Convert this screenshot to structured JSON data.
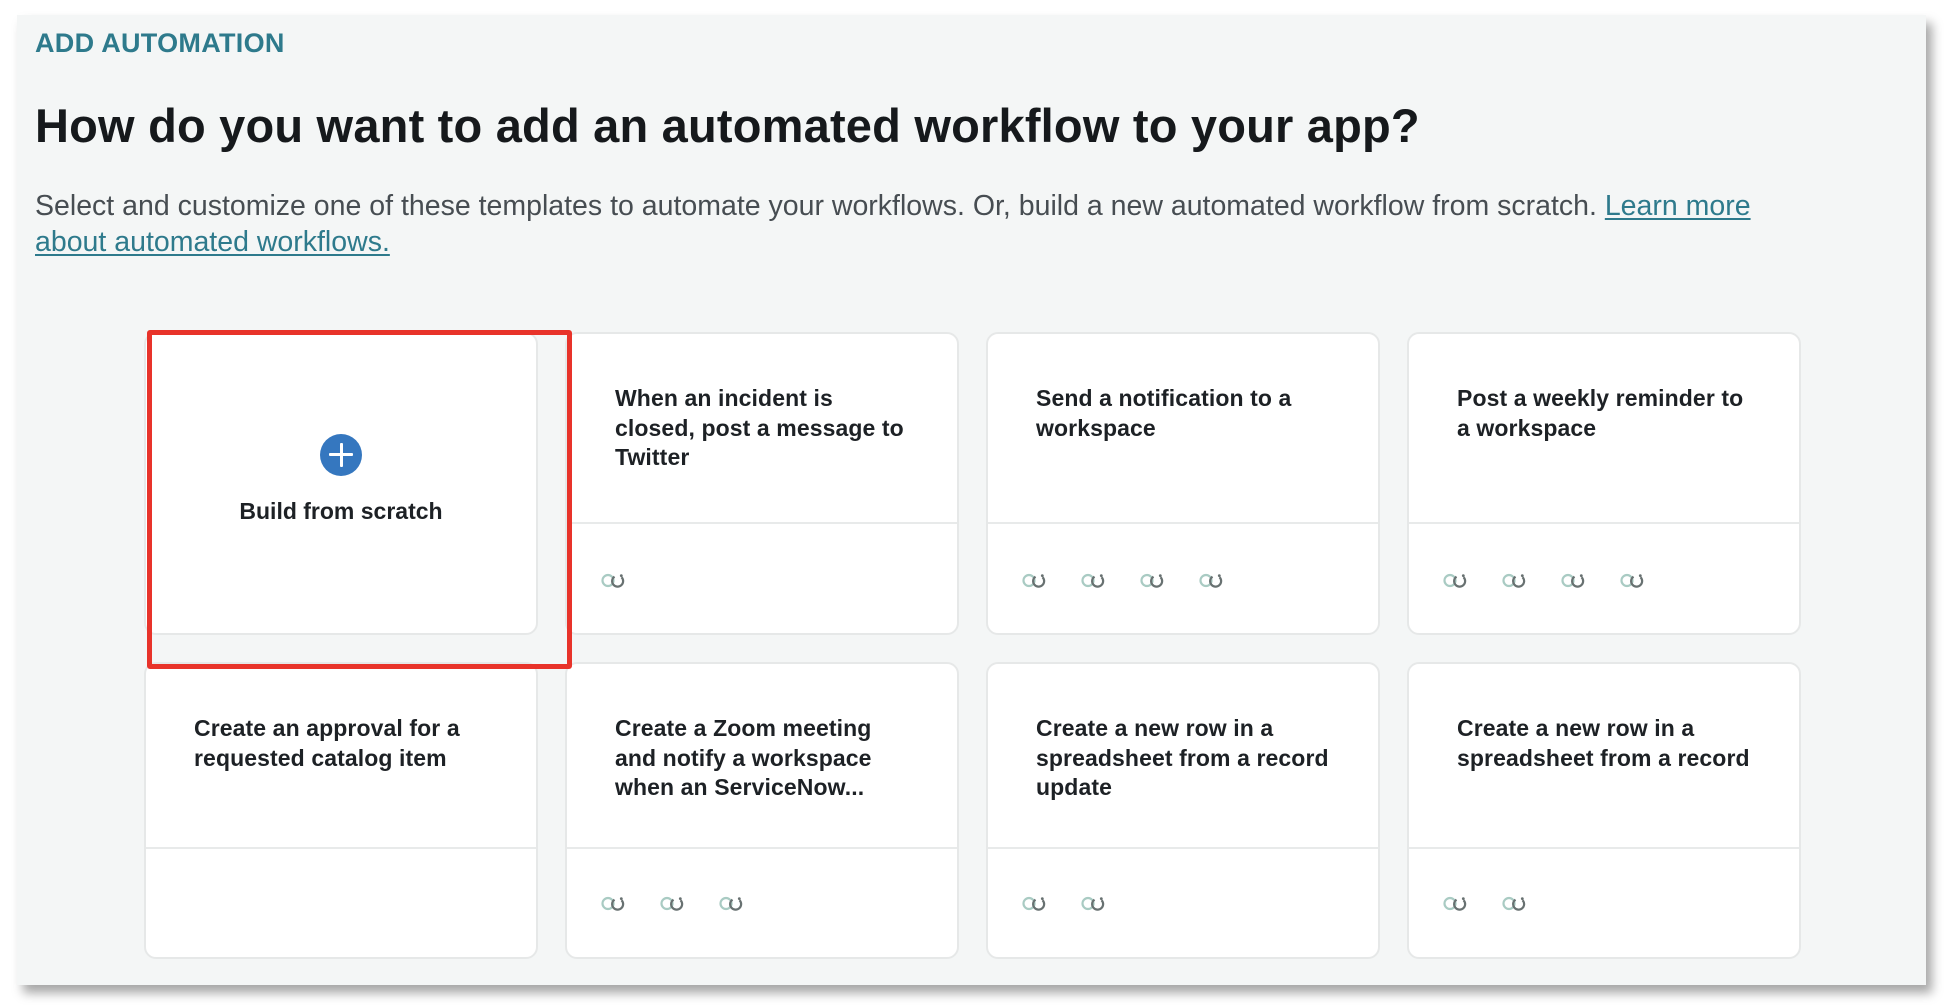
{
  "header": {
    "eyebrow": "ADD AUTOMATION",
    "title": "How do you want to add an automated workflow to your app?",
    "subtitle": "Select and customize one of these templates to automate your workflows. Or, build a new automated workflow from scratch.",
    "learn_more_line1": "Learn more",
    "learn_more_line2": "about automated workflows."
  },
  "colors": {
    "accent": "#2e7a8c",
    "plus_button": "#3577bf",
    "highlight": "#e8332a",
    "panel_background": "#f4f6f6"
  },
  "scratch_card": {
    "icon": "plus-circle-icon",
    "label": "Build from scratch",
    "highlighted": true
  },
  "templates": [
    {
      "title": "When an incident is closed, post a message to Twitter",
      "app_icons": [
        "connector-icon"
      ]
    },
    {
      "title": "Send a notification to a workspace",
      "app_icons": [
        "connector-icon",
        "connector-icon",
        "connector-icon",
        "connector-icon"
      ]
    },
    {
      "title": "Post a weekly reminder to a workspace",
      "app_icons": [
        "connector-icon",
        "connector-icon",
        "connector-icon",
        "connector-icon"
      ]
    },
    {
      "title": "Create an approval for a requested catalog item",
      "app_icons": []
    },
    {
      "title": "Create a Zoom meeting and notify a workspace when an ServiceNow...",
      "app_icons": [
        "connector-icon",
        "connector-icon",
        "connector-icon"
      ]
    },
    {
      "title": "Create a new row in a spreadsheet from a record update",
      "app_icons": [
        "connector-icon",
        "connector-icon"
      ]
    },
    {
      "title": "Create a new row in a spreadsheet from a record",
      "app_icons": [
        "connector-icon",
        "connector-icon"
      ]
    }
  ]
}
